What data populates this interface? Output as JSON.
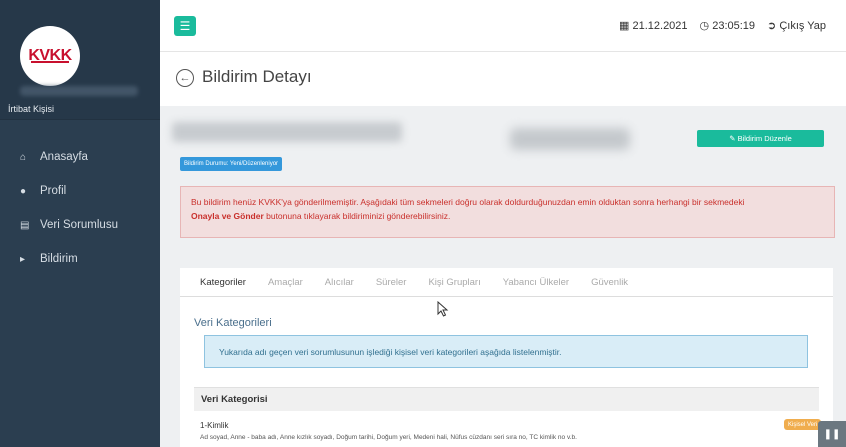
{
  "sidebar": {
    "logo_text": "KVKK",
    "user_role": "İrtibat Kişisi",
    "items": [
      {
        "label": "Anasayfa",
        "icon": "home-icon"
      },
      {
        "label": "Profil",
        "icon": "user-icon"
      },
      {
        "label": "Veri Sorumlusu",
        "icon": "database-icon"
      },
      {
        "label": "Bildirim",
        "icon": "megaphone-icon"
      }
    ]
  },
  "topbar": {
    "date": "21.12.2021",
    "time": "23:05:19",
    "logout": "Çıkış Yap"
  },
  "page": {
    "title": "Bildirim Detayı"
  },
  "notice": {
    "status_badge": "Bildirim Durumu: Yeni/Düzenleniyor",
    "edit_button": "Bildirim Düzenle",
    "alert_text_1": "Bu bildirim henüz KVKK'ya gönderilmemiştir. Aşağıdaki tüm sekmeleri doğru olarak doldurduğunuzdan emin olduktan sonra herhangi bir sekmedeki",
    "alert_bold": "Onayla ve Gönder",
    "alert_text_2": " butonuna tıklayarak bildiriminizi gönderebilirsiniz."
  },
  "tabs": [
    "Kategoriler",
    "Amaçlar",
    "Alıcılar",
    "Süreler",
    "Kişi Grupları",
    "Yabancı Ülkeler",
    "Güvenlik"
  ],
  "panel": {
    "title": "Veri Kategorileri",
    "info": "Yukarıda adı geçen veri sorumlusunun işlediği kişisel veri kategorileri aşağıda listelenmiştir.",
    "table_header": "Veri Kategorisi",
    "row_title": "1-Kimlik",
    "row_badge": "Kişisel Veri",
    "row_desc": "Ad soyad, Anne - baba adı, Anne kızlık soyadı, Doğum tarihi, Doğum yeri, Medeni hali, Nüfus cüzdanı seri sıra no, TC kimlik no v.b."
  },
  "colors": {
    "sidebar": "#2b3e50",
    "accent": "#1abb9c",
    "alert_bg": "#f2dede",
    "alert_text": "#c9302c",
    "info_bg": "#d9edf7",
    "badge_blue": "#3498db",
    "badge_orange": "#f0ad4e"
  }
}
